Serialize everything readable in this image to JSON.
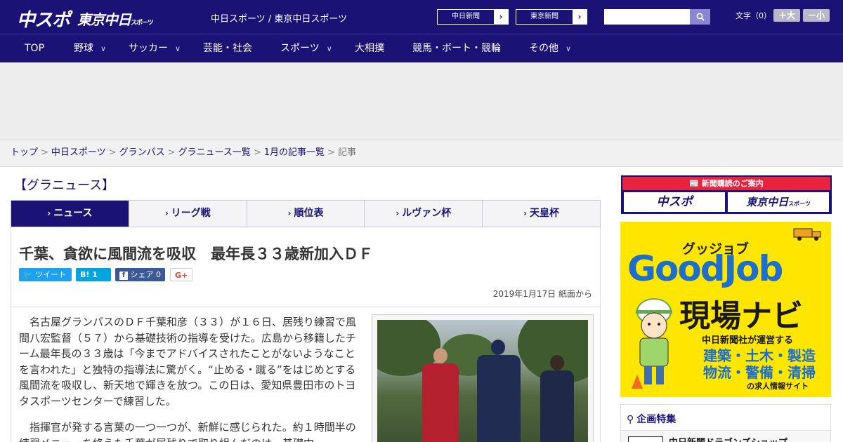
{
  "header": {
    "logo_main": "中スポ",
    "logo_sub": "東京中日",
    "logo_sub_small": "スポーツ",
    "site_name": "中日スポーツ / 東京中日スポーツ",
    "ext_links": [
      {
        "label": "中日新聞",
        "arrow": "›"
      },
      {
        "label": "東京新聞",
        "arrow": "›"
      }
    ],
    "search_placeholder": "",
    "font_size_label": "文字（0）",
    "font_bigger": "＋大",
    "font_smaller": "－小"
  },
  "nav": {
    "items": [
      {
        "label": "TOP"
      },
      {
        "label": "野球",
        "chevron": "∨"
      },
      {
        "label": "サッカー",
        "chevron": "∨"
      },
      {
        "label": "芸能・社会"
      },
      {
        "label": "スポーツ",
        "chevron": "∨"
      },
      {
        "label": "大相撲"
      },
      {
        "label": "競馬・ボート・競輪"
      },
      {
        "label": "その他",
        "chevron": "∨"
      }
    ]
  },
  "breadcrumb": {
    "items": [
      "トップ",
      "中日スポーツ",
      "グランパス",
      "グラニュース一覧",
      "1月の記事一覧"
    ],
    "current": "記事",
    "sep": ">"
  },
  "section": {
    "title": "【グラニュース】"
  },
  "tabs": [
    {
      "label": "ニュース",
      "marker": "›",
      "active": true
    },
    {
      "label": "リーグ戦",
      "marker": "›"
    },
    {
      "label": "順位表",
      "marker": "›"
    },
    {
      "label": "ルヴァン杯",
      "marker": "›"
    },
    {
      "label": "天皇杯",
      "marker": "›"
    }
  ],
  "article": {
    "headline": "千葉、貪欲に風間流を吸収　最年長３３歳新加入ＤＦ",
    "share": {
      "tweet": "ツイート",
      "hatena": "B! 1",
      "facebook": "シェア 0",
      "gplus": "G+"
    },
    "date": "2019年1月17日 紙面から",
    "paragraphs": [
      "名古屋グランパスのＤＦ千葉和彦（３３）が１６日、居残り練習で風間八宏監督（５７）から基礎技術の指導を受けた。広島から移籍したチーム最年長の３３歳は「今までアドバイスされたことがないようなことを言われた」と独特の指導法に驚がく。“止める・蹴る”をはじめとする風間流を吸収し、新天地で輝きを放つ。この日は、愛知県豊田市のトヨタスポーツセンターで練習した。",
      "指揮官が発する言葉の一つ一つが、新鮮に感じられた。約１時間半の練習メニューを終えた千葉が居残りで取り組んだのは、基礎中"
    ]
  },
  "sidebar": {
    "subscribe_label": "新聞購読のご案内",
    "subscribe_left": "中スポ",
    "subscribe_right": "東京中日",
    "subscribe_right_small": "スポーツ",
    "goodjob": {
      "kana": "グッジョブ",
      "title": "GoodJob",
      "navi": "現場ナビ",
      "line1": "中日新聞社が運営する",
      "line2": "建築・土木・製造",
      "line3": "物流・警備・清掃",
      "line4": "の求人情報サイト"
    },
    "feature": {
      "heading": "企画特集",
      "item": "中日新聞ドラゴンズショップ"
    }
  },
  "colors": {
    "brand_navy": "#1a1275",
    "sub_red": "#e8233e",
    "goodjob_yellow": "#ffe600",
    "goodjob_blue": "#1d6fc9"
  }
}
